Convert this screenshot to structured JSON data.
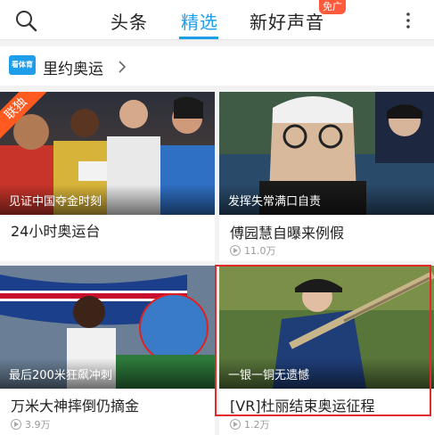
{
  "topbar": {
    "tabs": [
      {
        "label": "头条"
      },
      {
        "label": "精选",
        "active": true
      },
      {
        "label": "新好声音"
      }
    ],
    "badge": "免广",
    "accent": "#1e9ee8"
  },
  "section": {
    "title": "里约奥运",
    "logo_text": "看体育"
  },
  "cards": [
    {
      "caption": "见证中国夺金时刻",
      "title": "24小时奥运台",
      "views": "",
      "tag": "联独"
    },
    {
      "caption": "发挥失常满口自责",
      "title": "傅园慧自曝来例假",
      "views": "11.0万"
    },
    {
      "caption": "最后200米狂飙冲刺",
      "title": "万米大神摔倒仍摘金",
      "views": "3.9万"
    },
    {
      "caption": "一银一铜无遗憾",
      "title": "[VR]杜丽结束奥运征程",
      "views": "1.2万"
    }
  ]
}
